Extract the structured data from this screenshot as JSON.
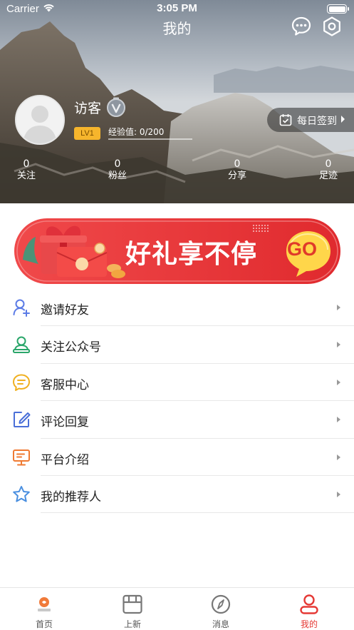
{
  "status_bar": {
    "carrier": "Carrier",
    "time": "3:05 PM"
  },
  "nav": {
    "title": "我的",
    "icons": [
      "message-icon",
      "settings-icon"
    ]
  },
  "profile": {
    "username": "访客",
    "level": "LV1",
    "exp_label": "经验值: 0/200",
    "exp_fraction": 0.0
  },
  "checkin": {
    "label": "每日签到"
  },
  "stats": [
    {
      "value": "0",
      "label": "关注"
    },
    {
      "value": "0",
      "label": "粉丝"
    },
    {
      "value": "0",
      "label": "分享"
    },
    {
      "value": "0",
      "label": "足迹"
    }
  ],
  "banner": {
    "text": "好礼享不停",
    "go": "GO"
  },
  "menu": [
    {
      "label": "邀请好友",
      "icon": "invite-friend-icon"
    },
    {
      "label": "关注公众号",
      "icon": "follow-account-icon"
    },
    {
      "label": "客服中心",
      "icon": "customer-service-icon"
    },
    {
      "label": "评论回复",
      "icon": "comment-reply-icon"
    },
    {
      "label": "平台介绍",
      "icon": "platform-intro-icon"
    },
    {
      "label": "我的推荐人",
      "icon": "referrer-star-icon"
    }
  ],
  "tabbar": [
    {
      "label": "首页",
      "icon": "home-logo-icon"
    },
    {
      "label": "上新",
      "icon": "new-arrivals-icon"
    },
    {
      "label": "消息",
      "icon": "compass-icon"
    },
    {
      "label": "我的",
      "icon": "profile-icon",
      "active": true
    }
  ],
  "colors": {
    "accent": "#e53935",
    "level_badge": "#f6b52c",
    "banner_red": "#e8383a"
  }
}
